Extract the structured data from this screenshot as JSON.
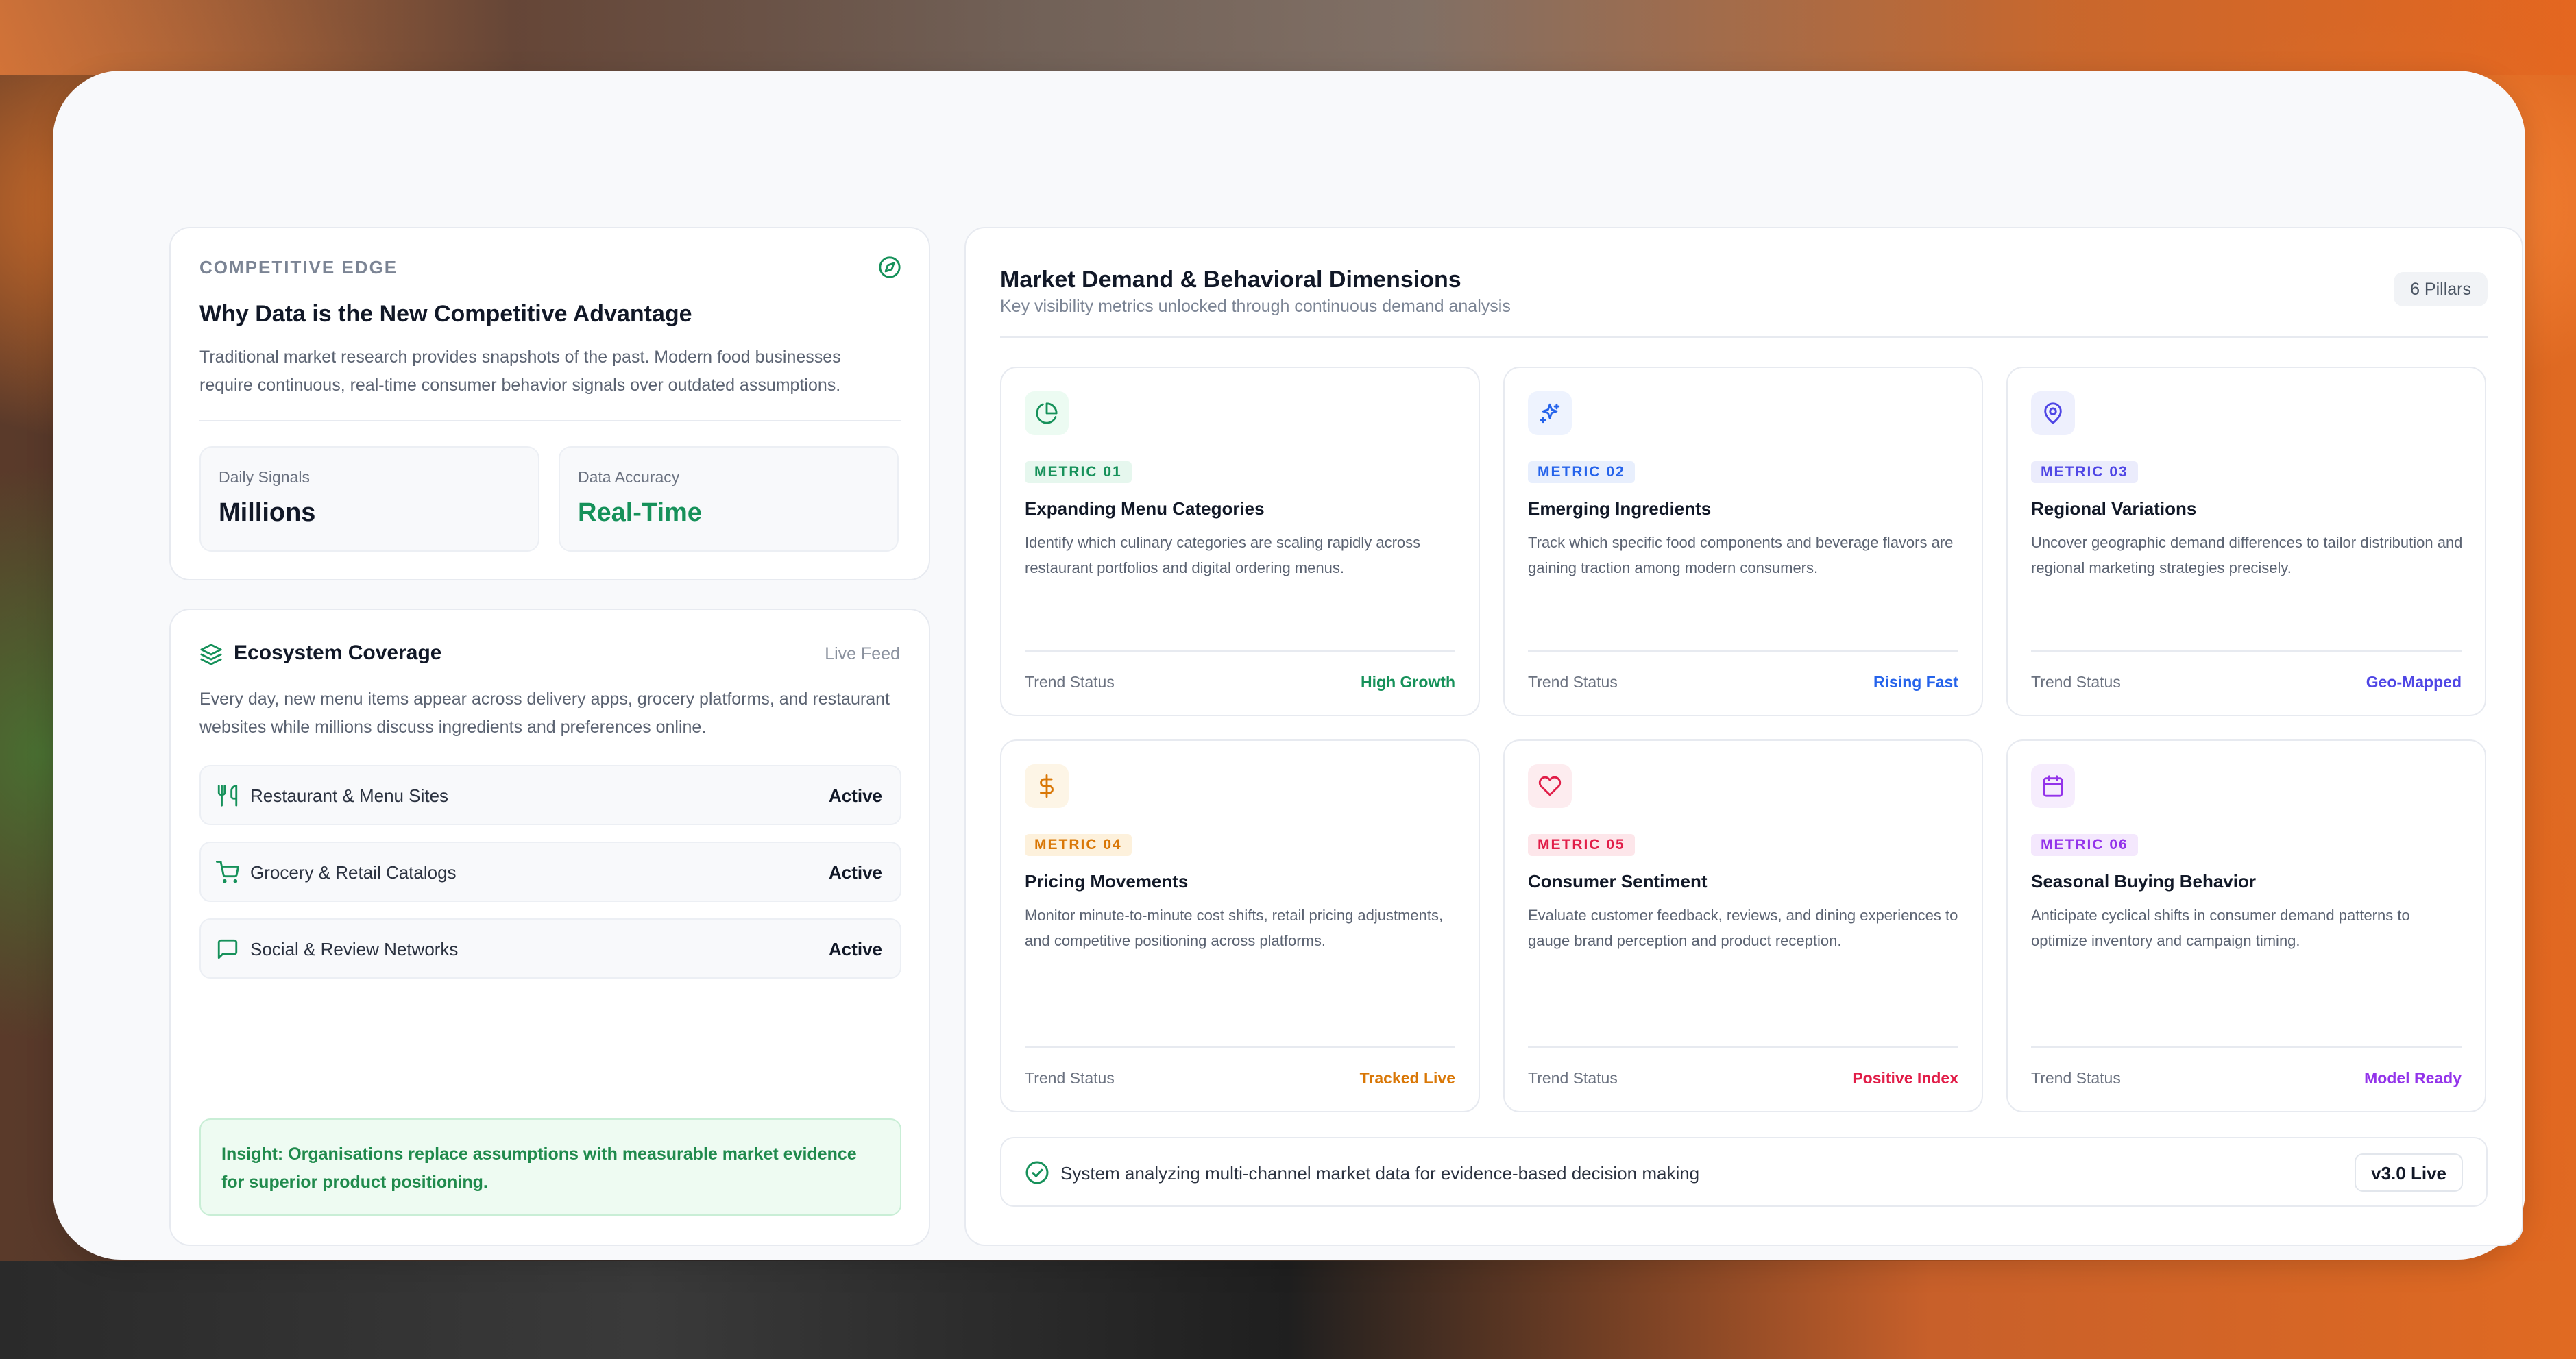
{
  "edge": {
    "eyebrow": "COMPETITIVE EDGE",
    "title": "Why Data is the New Competitive Advantage",
    "description": "Traditional market research provides snapshots of the past. Modern food businesses require continuous, real-time consumer behavior signals over outdated assumptions.",
    "stats": [
      {
        "label": "Daily Signals",
        "value": "Millions"
      },
      {
        "label": "Data Accuracy",
        "value": "Real-Time"
      }
    ]
  },
  "ecosystem": {
    "title": "Ecosystem Coverage",
    "live_label": "Live Feed",
    "description": "Every day, new menu items appear across delivery apps, grocery platforms, and restaurant websites while millions discuss ingredients and preferences online.",
    "sources": [
      {
        "name": "Restaurant & Menu Sites",
        "status": "Active",
        "icon": "utensils-icon"
      },
      {
        "name": "Grocery & Retail Catalogs",
        "status": "Active",
        "icon": "cart-icon"
      },
      {
        "name": "Social & Review Networks",
        "status": "Active",
        "icon": "chat-icon"
      }
    ],
    "insight": "Insight: Organisations replace assumptions with measurable market evidence for superior product positioning."
  },
  "market": {
    "title": "Market Demand & Behavioral Dimensions",
    "subtitle": "Key visibility metrics unlocked through continuous demand analysis",
    "pill": "6 Pillars",
    "metrics": [
      {
        "tag": "METRIC 01",
        "title": "Expanding Menu Categories",
        "description": "Identify which culinary categories are scaling rapidly across restaurant portfolios and digital ordering menus.",
        "status_label": "Trend Status",
        "status": "High Growth",
        "color": "#16915a",
        "icon": "pie-chart-icon"
      },
      {
        "tag": "METRIC 02",
        "title": "Emerging Ingredients",
        "description": "Track which specific food components and beverage flavors are gaining traction among modern consumers.",
        "status_label": "Trend Status",
        "status": "Rising Fast",
        "color": "#2563eb",
        "icon": "sparkles-icon"
      },
      {
        "tag": "METRIC 03",
        "title": "Regional Variations",
        "description": "Uncover geographic demand differences to tailor distribution and regional marketing strategies precisely.",
        "status_label": "Trend Status",
        "status": "Geo-Mapped",
        "color": "#4f46e5",
        "icon": "map-pin-icon"
      },
      {
        "tag": "METRIC 04",
        "title": "Pricing Movements",
        "description": "Monitor minute-to-minute cost shifts, retail pricing adjustments, and competitive positioning across platforms.",
        "status_label": "Trend Status",
        "status": "Tracked Live",
        "color": "#d97706",
        "icon": "dollar-icon"
      },
      {
        "tag": "METRIC 05",
        "title": "Consumer Sentiment",
        "description": "Evaluate customer feedback, reviews, and dining experiences to gauge brand perception and product reception.",
        "status_label": "Trend Status",
        "status": "Positive Index",
        "color": "#e11d48",
        "icon": "heart-icon"
      },
      {
        "tag": "METRIC 06",
        "title": "Seasonal Buying Behavior",
        "description": "Anticipate cyclical shifts in consumer demand patterns to optimize inventory and campaign timing.",
        "status_label": "Trend Status",
        "status": "Model Ready",
        "color": "#9333ea",
        "icon": "calendar-icon"
      }
    ],
    "footer": {
      "message": "System analyzing multi-channel market data for evidence-based decision making",
      "version": "v3.0 Live"
    }
  }
}
